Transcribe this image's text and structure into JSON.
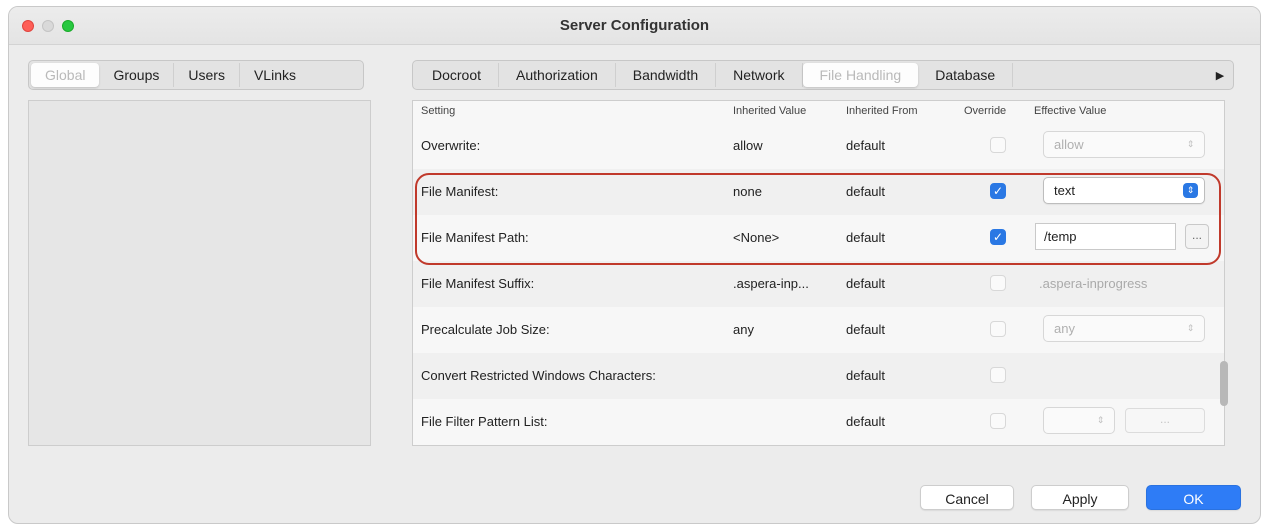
{
  "window": {
    "title": "Server Configuration"
  },
  "left_tabs": [
    "Global",
    "Groups",
    "Users",
    "VLinks"
  ],
  "right_tabs": [
    "Docroot",
    "Authorization",
    "Bandwidth",
    "Network",
    "File Handling",
    "Database"
  ],
  "right_tabs_more": "▶",
  "table": {
    "headers": {
      "setting": "Setting",
      "inherited_value": "Inherited Value",
      "inherited_from": "Inherited From",
      "override": "Override",
      "effective_value": "Effective Value"
    },
    "rows": [
      {
        "setting": "Overwrite:",
        "inherited_value": "allow",
        "inherited_from": "default",
        "override": false,
        "effective_value": "allow"
      },
      {
        "setting": "File Manifest:",
        "inherited_value": "none",
        "inherited_from": "default",
        "override": true,
        "effective_value": "text"
      },
      {
        "setting": "File Manifest Path:",
        "inherited_value": "<None>",
        "inherited_from": "default",
        "override": true,
        "effective_value": "/temp",
        "browse": "..."
      },
      {
        "setting": "File Manifest Suffix:",
        "inherited_value": ".aspera-inp...",
        "inherited_from": "default",
        "override": false,
        "effective_value": ".aspera-inprogress"
      },
      {
        "setting": "Precalculate Job Size:",
        "inherited_value": "any",
        "inherited_from": "default",
        "override": false,
        "effective_value": "any"
      },
      {
        "setting": "Convert Restricted Windows Characters:",
        "inherited_value": "",
        "inherited_from": "default",
        "override": false,
        "effective_value": ""
      },
      {
        "setting": "File Filter Pattern List:",
        "inherited_value": "",
        "inherited_from": "default",
        "override": false,
        "effective_value": "",
        "browse": "..."
      }
    ]
  },
  "buttons": {
    "cancel": "Cancel",
    "apply": "Apply",
    "ok": "OK"
  },
  "colors": {
    "highlight": "#c0392b",
    "accent": "#2e7cf6",
    "checkbox": "#2a78e4"
  },
  "icons": {
    "check": "✓",
    "updown": "⇕"
  }
}
